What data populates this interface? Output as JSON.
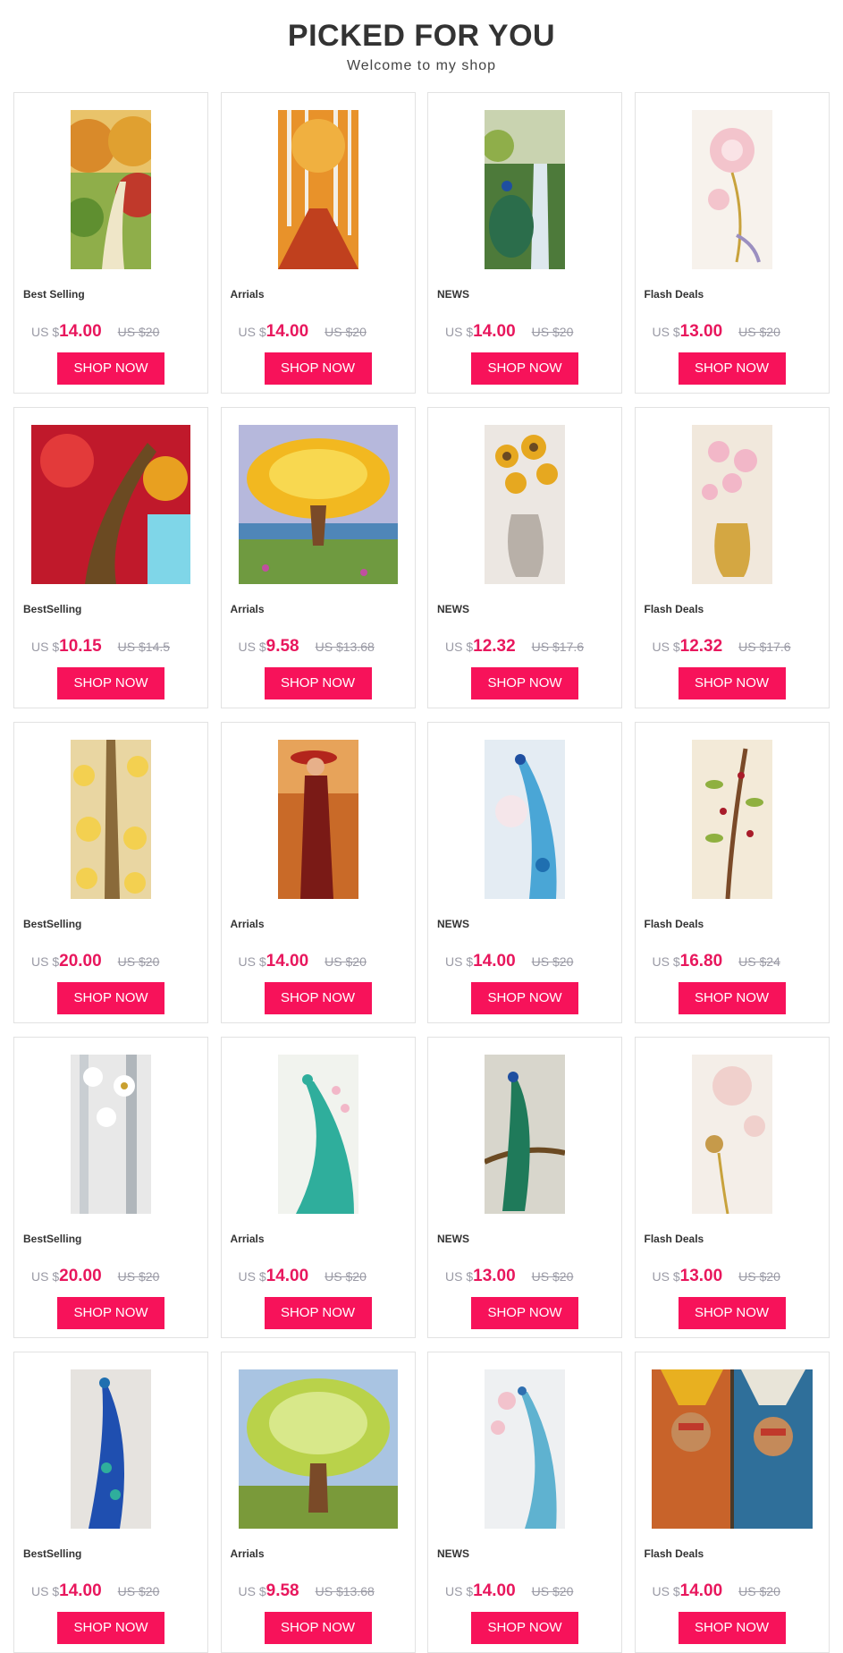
{
  "header": {
    "title": "PICKED FOR YOU",
    "subtitle": "Welcome to my shop"
  },
  "products": [
    {
      "category": "Best Selling",
      "currency": "US $",
      "price": "14.00",
      "old_price": "US $20",
      "button": "SHOP NOW",
      "image": "autumn-path-painting",
      "shape": "tall"
    },
    {
      "category": "Arrials",
      "currency": "US $",
      "price": "14.00",
      "old_price": "US $20",
      "button": "SHOP NOW",
      "image": "autumn-birch-forest-painting",
      "shape": "tall"
    },
    {
      "category": "NEWS",
      "currency": "US $",
      "price": "14.00",
      "old_price": "US $20",
      "button": "SHOP NOW",
      "image": "peacock-waterfall-painting",
      "shape": "tall"
    },
    {
      "category": "Flash Deals",
      "currency": "US $",
      "price": "13.00",
      "old_price": "US $20",
      "button": "SHOP NOW",
      "image": "pink-lotus-art",
      "shape": "tall"
    },
    {
      "category": "BestSelling",
      "currency": "US $",
      "price": "10.15",
      "old_price": "US $14.5",
      "button": "SHOP NOW",
      "image": "red-tree-painting",
      "shape": "wide"
    },
    {
      "category": "Arrials",
      "currency": "US $",
      "price": "9.58",
      "old_price": "US $13.68",
      "button": "SHOP NOW",
      "image": "golden-tree-lake-painting",
      "shape": "wide"
    },
    {
      "category": "NEWS",
      "currency": "US $",
      "price": "12.32",
      "old_price": "US $17.6",
      "button": "SHOP NOW",
      "image": "sunflower-vase-art",
      "shape": "tall"
    },
    {
      "category": "Flash Deals",
      "currency": "US $",
      "price": "12.32",
      "old_price": "US $17.6",
      "button": "SHOP NOW",
      "image": "magnolia-gold-vase-art",
      "shape": "tall"
    },
    {
      "category": "BestSelling",
      "currency": "US $",
      "price": "20.00",
      "old_price": "US $20",
      "button": "SHOP NOW",
      "image": "yellow-blossom-tree-art",
      "shape": "tall"
    },
    {
      "category": "Arrials",
      "currency": "US $",
      "price": "14.00",
      "old_price": "US $20",
      "button": "SHOP NOW",
      "image": "woman-red-hat-painting",
      "shape": "tall"
    },
    {
      "category": "NEWS",
      "currency": "US $",
      "price": "14.00",
      "old_price": "US $20",
      "button": "SHOP NOW",
      "image": "blue-peacock-lotus-art",
      "shape": "tall"
    },
    {
      "category": "Flash Deals",
      "currency": "US $",
      "price": "16.80",
      "old_price": "US $24",
      "button": "SHOP NOW",
      "image": "berry-branch-art",
      "shape": "tall"
    },
    {
      "category": "BestSelling",
      "currency": "US $",
      "price": "20.00",
      "old_price": "US $20",
      "button": "SHOP NOW",
      "image": "white-flower-birch-art",
      "shape": "tall"
    },
    {
      "category": "Arrials",
      "currency": "US $",
      "price": "14.00",
      "old_price": "US $20",
      "button": "SHOP NOW",
      "image": "teal-peacock-art",
      "shape": "tall"
    },
    {
      "category": "NEWS",
      "currency": "US $",
      "price": "13.00",
      "old_price": "US $20",
      "button": "SHOP NOW",
      "image": "green-peacock-branch-art",
      "shape": "tall"
    },
    {
      "category": "Flash Deals",
      "currency": "US $",
      "price": "13.00",
      "old_price": "US $20",
      "button": "SHOP NOW",
      "image": "lotus-seedpod-art",
      "shape": "tall"
    },
    {
      "category": "BestSelling",
      "currency": "US $",
      "price": "14.00",
      "old_price": "US $20",
      "button": "SHOP NOW",
      "image": "royal-blue-peacock-art",
      "shape": "tall"
    },
    {
      "category": "Arrials",
      "currency": "US $",
      "price": "9.58",
      "old_price": "US $13.68",
      "button": "SHOP NOW",
      "image": "green-blossom-tree-painting",
      "shape": "wide"
    },
    {
      "category": "NEWS",
      "currency": "US $",
      "price": "14.00",
      "old_price": "US $20",
      "button": "SHOP NOW",
      "image": "pastel-peacock-art",
      "shape": "tall"
    },
    {
      "category": "Flash Deals",
      "currency": "US $",
      "price": "14.00",
      "old_price": "US $20",
      "button": "SHOP NOW",
      "image": "native-portraits-art",
      "shape": "xwide"
    }
  ],
  "colors": {
    "accent": "#f7125a",
    "price": "#e8175d",
    "muted": "#9a9aa5",
    "border": "#e2e2e2"
  }
}
